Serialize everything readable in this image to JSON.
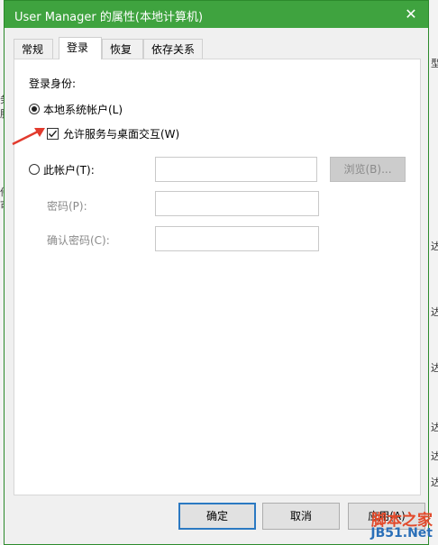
{
  "window": {
    "title": "User Manager 的属性(本地计算机)",
    "close_glyph": "✕",
    "titlebar_color": "#3fa33f"
  },
  "tabs": [
    {
      "label": "常规",
      "active": false
    },
    {
      "label": "登录",
      "active": true
    },
    {
      "label": "恢复",
      "active": false
    },
    {
      "label": "依存关系",
      "active": false
    }
  ],
  "logon": {
    "section_label": "登录身份:",
    "local_system": {
      "label": "本地系统帐户(L)",
      "selected": true
    },
    "allow_desktop": {
      "label": "允许服务与桌面交互(W)",
      "checked": true
    },
    "this_account": {
      "label": "此帐户(T):",
      "selected": false,
      "value": ""
    },
    "browse_label": "浏览(B)...",
    "password_label": "密码(P):",
    "password_value": "",
    "confirm_label": "确认密码(C):",
    "confirm_value": ""
  },
  "buttons": {
    "ok": "确定",
    "cancel": "取消",
    "apply": "应用(A)"
  },
  "watermark": {
    "line1": "脚本之家",
    "line2": "JB51.Net"
  },
  "background": {
    "left_glyphs": [
      "务",
      "服",
      "件",
      "可"
    ],
    "right_glyphs": [
      "型",
      "达",
      "达",
      "达",
      "达",
      "达",
      "达"
    ]
  },
  "colors": {
    "accent": "#2b79c2",
    "arrow": "#e23b2e"
  }
}
